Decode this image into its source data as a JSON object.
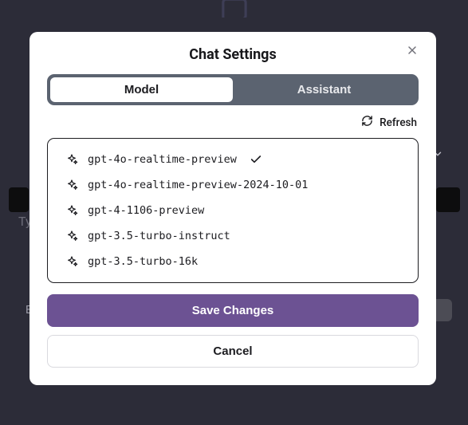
{
  "modal": {
    "title": "Chat Settings",
    "tabs": {
      "model": "Model",
      "assistant": "Assistant"
    },
    "refresh_label": "Refresh",
    "models": [
      {
        "name": "gpt-4o-realtime-preview",
        "selected": true
      },
      {
        "name": "gpt-4o-realtime-preview-2024-10-01",
        "selected": false
      },
      {
        "name": "gpt-4-1106-preview",
        "selected": false
      },
      {
        "name": "gpt-3.5-turbo-instruct",
        "selected": false
      },
      {
        "name": "gpt-3.5-turbo-16k",
        "selected": false
      }
    ],
    "save_label": "Save Changes",
    "cancel_label": "Cancel"
  },
  "background": {
    "placeholder_hint": "Ty",
    "letter_hint": "E"
  },
  "colors": {
    "accent": "#6c5293",
    "segmented_bg": "#5b6370",
    "border": "#1c1c20"
  }
}
